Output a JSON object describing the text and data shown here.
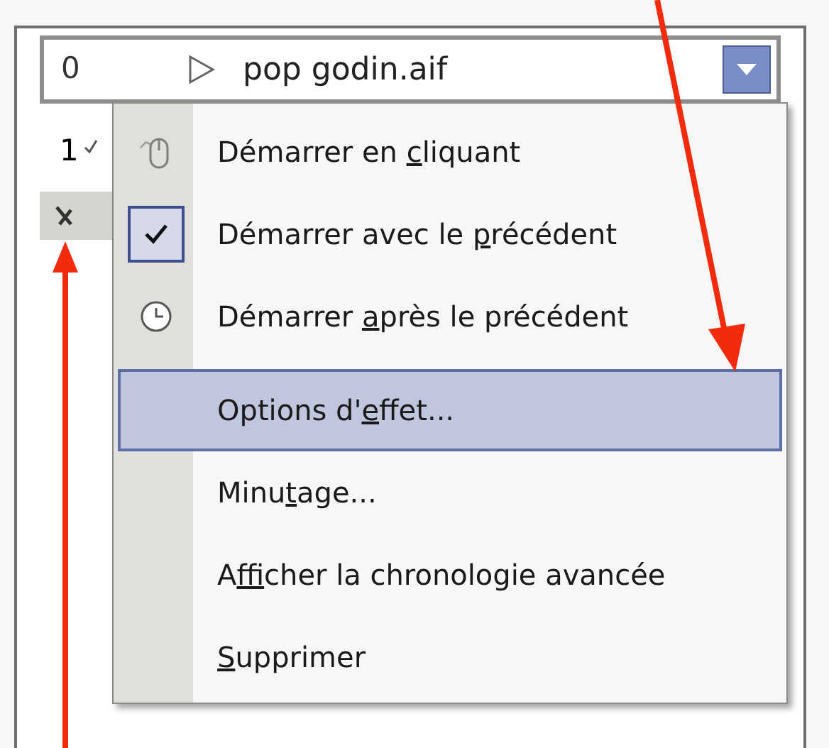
{
  "combo": {
    "index": "0",
    "name": "pop godin.aif"
  },
  "list": {
    "row_number": "1"
  },
  "menu": {
    "items": [
      {
        "kind": "mouse",
        "checked": false,
        "selected": false,
        "before": "Démarrer en ",
        "key": "c",
        "after": "liquant"
      },
      {
        "kind": "check",
        "checked": true,
        "selected": false,
        "before": "Démarrer avec le ",
        "key": "p",
        "after": "récédent"
      },
      {
        "kind": "clock",
        "checked": false,
        "selected": false,
        "before": "Démarrer ",
        "key": "a",
        "after": "près le précédent"
      },
      {
        "kind": "separator"
      },
      {
        "kind": "text",
        "selected": true,
        "before": "Options d'",
        "key": "e",
        "after": "ffet..."
      },
      {
        "kind": "text",
        "selected": false,
        "before": "Minu",
        "key": "t",
        "after": "age..."
      },
      {
        "kind": "text",
        "selected": false,
        "before": "A",
        "key": "f",
        "after": "ficher la chronologie avancée"
      },
      {
        "kind": "text",
        "selected": false,
        "key": "S",
        "after": "upprimer"
      }
    ]
  }
}
